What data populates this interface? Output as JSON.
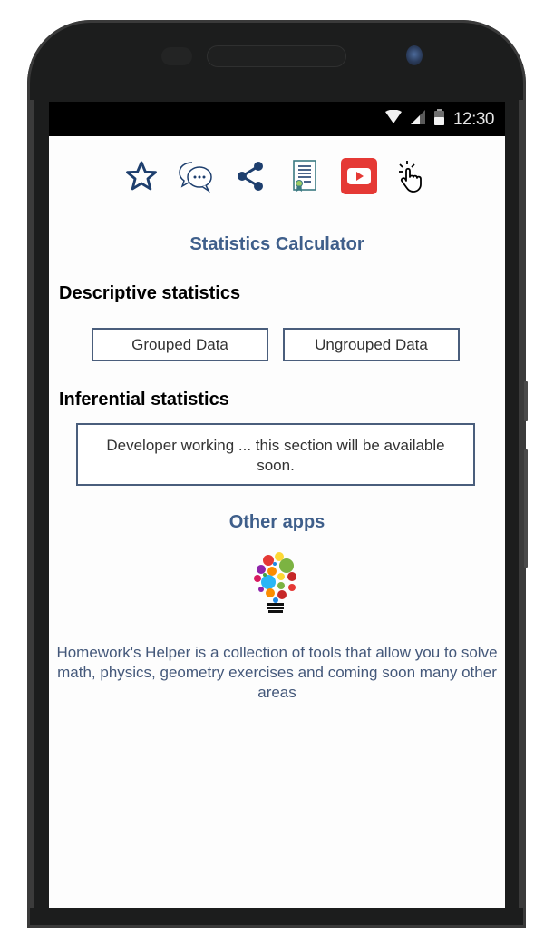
{
  "status_bar": {
    "time": "12:30",
    "icons": [
      "wifi-icon",
      "signal-icon",
      "battery-icon"
    ]
  },
  "toolbar": {
    "icons": [
      {
        "name": "star-icon",
        "label": "Rate"
      },
      {
        "name": "chat-icon",
        "label": "Comments"
      },
      {
        "name": "share-icon",
        "label": "Share"
      },
      {
        "name": "certificate-icon",
        "label": "Document"
      },
      {
        "name": "youtube-icon",
        "label": "Video"
      },
      {
        "name": "tap-icon",
        "label": "Touch"
      }
    ]
  },
  "colors": {
    "accent": "#3f5f8b",
    "icon_navy": "#1e3f6e",
    "youtube_red": "#e53935",
    "button_border": "#4a5e7c"
  },
  "main": {
    "title": "Statistics Calculator",
    "descriptive": {
      "heading": "Descriptive statistics",
      "buttons": [
        "Grouped Data",
        "Ungrouped Data"
      ]
    },
    "inferential": {
      "heading": "Inferential statistics",
      "message": "Developer working ... this section will be available soon."
    },
    "other_apps": {
      "heading": "Other apps",
      "app_icon": "lightbulb-icon",
      "description": "Homework's Helper is a collection of tools that allow you to solve math, physics, geometry exercises and coming soon many other areas"
    }
  }
}
